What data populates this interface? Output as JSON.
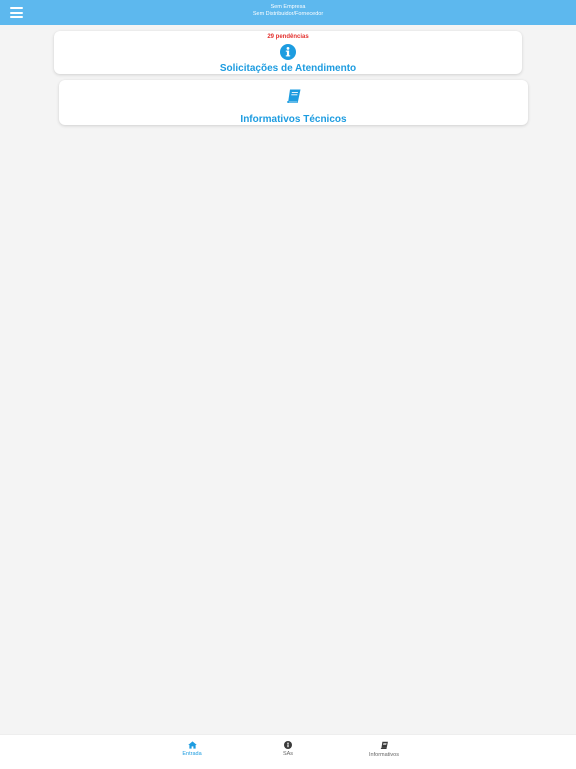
{
  "header": {
    "company": "Sem Empresa",
    "distributor": "Sem Distribuidor/Fornecedor"
  },
  "cards": [
    {
      "badge": "29 pendências",
      "title": "Solicitações de Atendimento",
      "icon": "info-circle-icon"
    },
    {
      "title": "Informativos Técnicos",
      "icon": "book-icon"
    }
  ],
  "tabbar": {
    "tabs": [
      {
        "label": "Entrada",
        "icon": "home-icon",
        "active": true
      },
      {
        "label": "SAs",
        "icon": "info-circle-icon",
        "active": false
      },
      {
        "label": "Informativos",
        "icon": "book-icon",
        "active": false
      }
    ]
  },
  "colors": {
    "header": "#5db8ee",
    "accent": "#1d9ce0",
    "badge": "#e3322f",
    "background": "#f4f4f4"
  }
}
